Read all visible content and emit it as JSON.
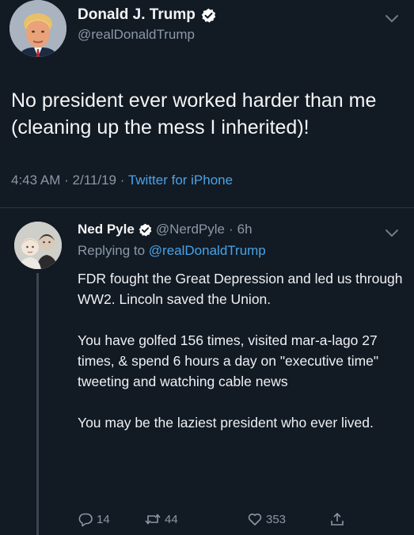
{
  "main_tweet": {
    "author": {
      "name": "Donald J. Trump",
      "handle": "@realDonaldTrump",
      "verified": true
    },
    "text": "No president ever worked harder than me (cleaning up the mess I inherited)!",
    "time": "4:43 AM",
    "date": "2/11/19",
    "separator": "·",
    "source": "Twitter for iPhone"
  },
  "reply": {
    "author": {
      "name": "Ned Pyle",
      "handle": "@NerdPyle",
      "verified": true
    },
    "separator": "·",
    "age": "6h",
    "replying_to_label": "Replying to",
    "replying_to_handle": "@realDonaldTrump",
    "paragraphs": [
      "FDR fought the Great Depression and led us through WW2. Lincoln saved the Union.",
      "You have golfed 156 times, visited mar-a-lago 27 times, & spend 6 hours a day on \"executive time\" tweeting and watching cable news",
      "You may be the laziest president who ever lived."
    ],
    "actions": {
      "reply_count": "14",
      "retweet_count": "44",
      "like_count": "353"
    }
  },
  "colors": {
    "background": "#121a23",
    "text": "#f3f5f7",
    "muted": "#8a98a6",
    "link": "#4aa3e8",
    "verified_badge": "#ffffff"
  },
  "icons": {
    "verified": "verified-check-icon",
    "more": "chevron-down-icon",
    "reply": "reply-bubble-icon",
    "retweet": "retweet-icon",
    "like": "heart-icon",
    "share": "share-icon"
  }
}
